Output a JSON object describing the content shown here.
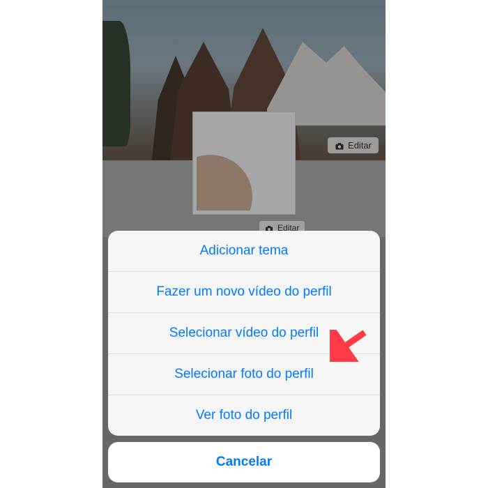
{
  "cover": {
    "edit_label": "Editar"
  },
  "profile": {
    "edit_label": "Editar"
  },
  "action_sheet": {
    "items": [
      {
        "label": "Adicionar tema"
      },
      {
        "label": "Fazer um novo vídeo do perfil"
      },
      {
        "label": "Selecionar vídeo do perfil"
      },
      {
        "label": "Selecionar foto do perfil"
      },
      {
        "label": "Ver foto do perfil"
      }
    ],
    "cancel_label": "Cancelar"
  },
  "icons": {
    "camera": "camera-icon",
    "pointer": "pointer-arrow"
  },
  "colors": {
    "accent": "#007aff"
  }
}
